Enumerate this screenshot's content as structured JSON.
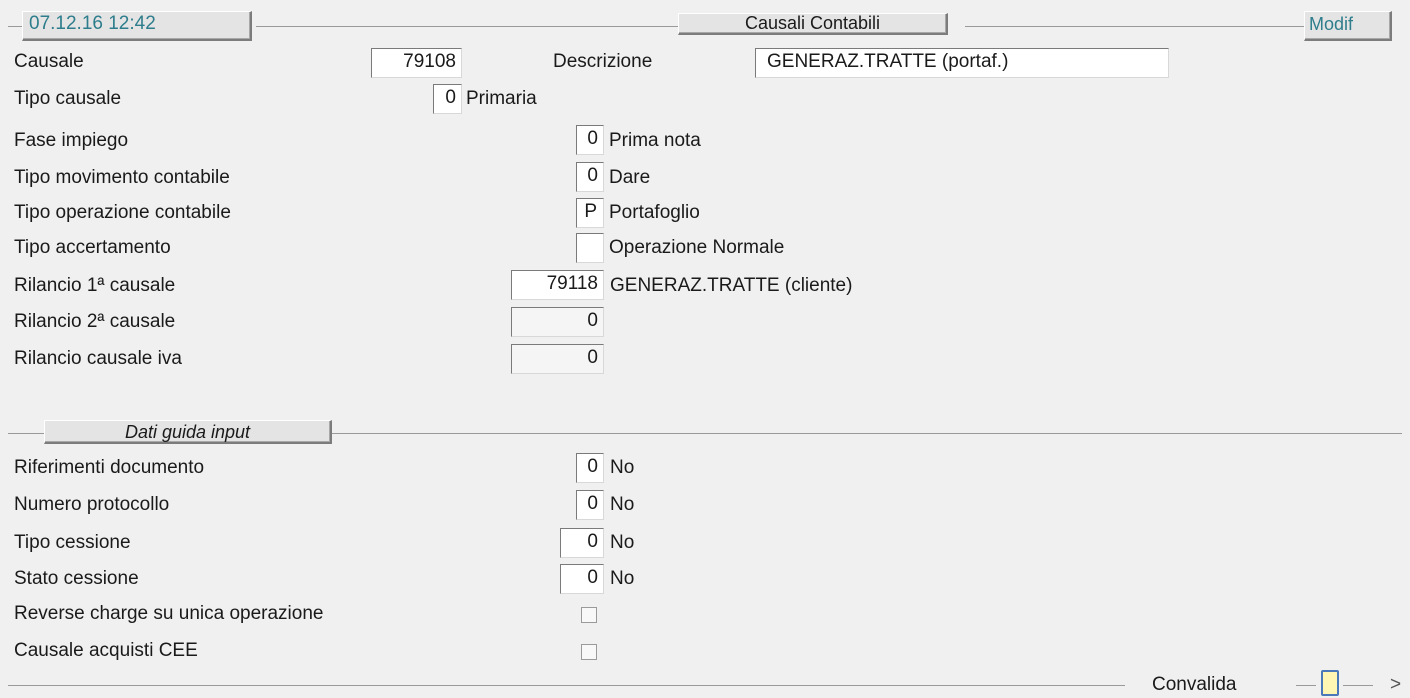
{
  "header": {
    "datetime": "07.12.16 12:42",
    "title": "Causali Contabili",
    "mode": "Modif"
  },
  "main": {
    "causale": {
      "label": "Causale",
      "value": "79108"
    },
    "descrizione": {
      "label": "Descrizione",
      "value": "GENERAZ.TRATTE  (portaf.)"
    },
    "tipo_causale": {
      "label": "Tipo causale",
      "value": "0",
      "desc": "Primaria"
    },
    "fase_impiego": {
      "label": "Fase impiego",
      "value": "0",
      "desc": "Prima nota"
    },
    "tipo_movimento": {
      "label": "Tipo movimento contabile",
      "value": "0",
      "desc": "Dare"
    },
    "tipo_operazione": {
      "label": "Tipo operazione contabile",
      "value": "P",
      "desc": "Portafoglio"
    },
    "tipo_accertamento": {
      "label": "Tipo accertamento",
      "value": "",
      "desc": "Operazione Normale"
    },
    "rilancio1": {
      "label": "Rilancio 1ª causale",
      "value": "79118",
      "desc": "GENERAZ.TRATTE  (cliente)"
    },
    "rilancio2": {
      "label": "Rilancio 2ª causale",
      "value": "0"
    },
    "rilancio_iva": {
      "label": "Rilancio causale iva",
      "value": "0"
    }
  },
  "guida": {
    "section_title": "Dati guida input",
    "riferimenti": {
      "label": "Riferimenti documento",
      "value": "0",
      "desc": "No"
    },
    "protocollo": {
      "label": "Numero protocollo",
      "value": "0",
      "desc": "No"
    },
    "tipo_cessione": {
      "label": "Tipo cessione",
      "value": "0",
      "desc": "No"
    },
    "stato_cessione": {
      "label": "Stato cessione",
      "value": "0",
      "desc": "No"
    },
    "reverse_charge": {
      "label": "Reverse charge su unica operazione",
      "checked": false
    },
    "acquisti_cee": {
      "label": "Causale acquisti CEE",
      "checked": false
    }
  },
  "footer": {
    "convalida_label": "Convalida",
    "next_label": ">"
  },
  "colors": {
    "accent_text": "#2e7d8c",
    "background": "#f0f0f0",
    "convalida_fill": "#fff6b3",
    "convalida_border": "#4a78b8"
  }
}
